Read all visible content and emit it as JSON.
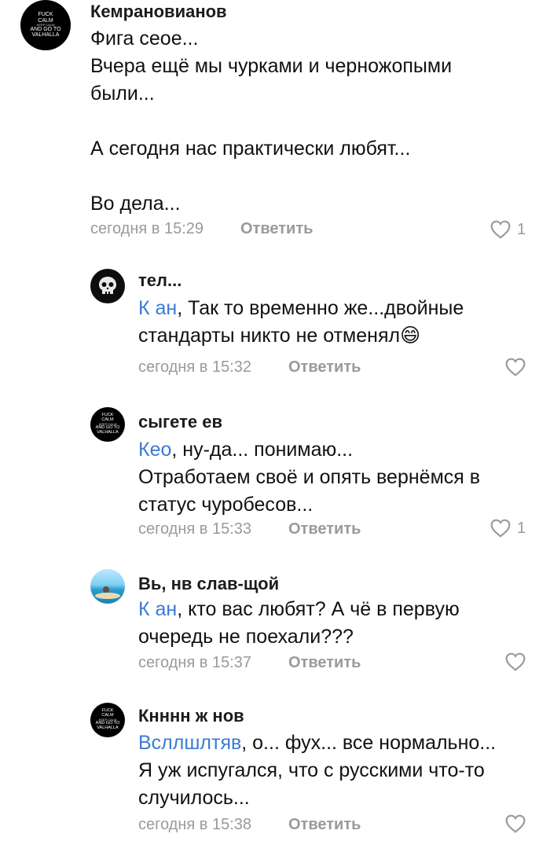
{
  "comments": [
    {
      "author": "Кемрановианов",
      "avatar": {
        "text_lines": [
          "FUCK",
          "CALM",
          "KEEP CALM",
          "AND GO TO",
          "VALHALLA"
        ],
        "style": "black"
      },
      "lines": [
        "Фига сеое...",
        "Вчера ещё мы чурками и черножопыми",
        "были...",
        "",
        "А сегодня нас практически любят...",
        "",
        "Во дела..."
      ],
      "time": "сегодня в 15:29",
      "reply_label": "Ответить",
      "likes": "1",
      "icons": {
        "like": "heart-icon"
      }
    },
    {
      "author": "тел...",
      "avatar": {
        "style": "skull"
      },
      "mention": "К ан",
      "text_after_mention": ", Так то временно же...двойные",
      "lines": [
        "стандарты никто не отменял😄"
      ],
      "time": "сегодня в 15:32",
      "reply_label": "Ответить",
      "likes": ""
    },
    {
      "author": "сыгете ев",
      "avatar": {
        "text_lines": [
          "FUCK",
          "CALM",
          "KEEP CALM",
          "AND GO TO",
          "VALHALLA"
        ],
        "style": "black"
      },
      "mention": "Кео",
      "text_after_mention": ", ну-да... понимаю...",
      "lines": [
        "Отработаем своё и опять вернёмся в",
        "статус чуробесов..."
      ],
      "time": "сегодня в 15:33",
      "reply_label": "Ответить",
      "likes": "1"
    },
    {
      "author": "Вь, нв слав-щой",
      "avatar": {
        "style": "beach"
      },
      "mention": "К ан",
      "text_after_mention": ", кто вас любят? А чё в первую",
      "lines": [
        "очередь не поехали???"
      ],
      "time": "сегодня в 15:37",
      "reply_label": "Ответить",
      "likes": ""
    },
    {
      "author": "Кнннн ж нов",
      "avatar": {
        "text_lines": [
          "FUCK",
          "CALM",
          "KEEP CALM",
          "AND GO TO",
          "VALHALLA"
        ],
        "style": "black"
      },
      "mention": "Всллшлтяв",
      "text_after_mention": ", о... фух... все нормально...",
      "lines": [
        "Я уж испугался, что с русскими что-то",
        "случилось..."
      ],
      "time": "сегодня в 15:38",
      "reply_label": "Ответить",
      "likes": ""
    }
  ],
  "colors": {
    "mention": "#3a7bd5",
    "meta": "#9a9a9a"
  }
}
